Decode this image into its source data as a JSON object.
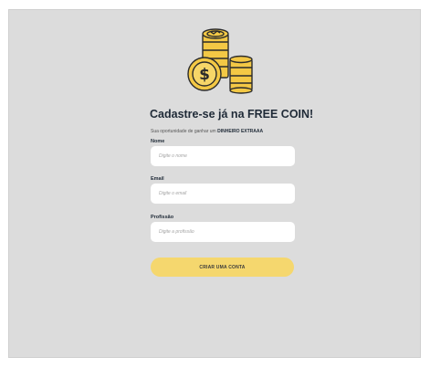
{
  "form": {
    "title": "Cadastre-se já na FREE COIN!",
    "subtitle_prefix": "Sua oportunidade de ganhar um ",
    "subtitle_highlight": "DINHEIRO EXTRAAA",
    "fields": [
      {
        "label": "Nome",
        "placeholder": "Digite o nome"
      },
      {
        "label": "Email",
        "placeholder": "Digite o email"
      },
      {
        "label": "Profissão",
        "placeholder": "Digite a profissão"
      }
    ],
    "submit_label": "CRIAR UMA CONTA"
  },
  "illustration": {
    "icon": "coin-stack-icon",
    "symbol": "$"
  },
  "colors": {
    "background": "#dcdcdc",
    "coin_fill": "#f3c845",
    "coin_stroke": "#2b2b2b",
    "button": "#f5d76e",
    "title": "#1f2a37"
  }
}
